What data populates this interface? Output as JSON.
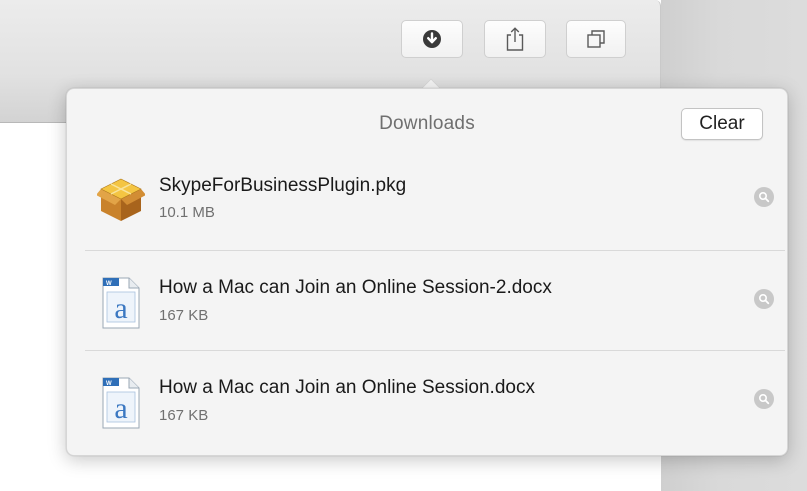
{
  "popover": {
    "title": "Downloads",
    "clear_label": "Clear"
  },
  "toolbar": {
    "buttons": [
      {
        "name": "downloads",
        "icon": "download-arrow-circle-icon"
      },
      {
        "name": "share",
        "icon": "share-icon"
      },
      {
        "name": "tabs",
        "icon": "tab-overview-icon"
      }
    ]
  },
  "downloads": [
    {
      "name": "SkypeForBusinessPlugin.pkg",
      "size": "10.1 MB",
      "icon": "package-icon"
    },
    {
      "name": "How a Mac can Join an Online Session-2.docx",
      "size": "167 KB",
      "icon": "word-document-icon"
    },
    {
      "name": "How a Mac can Join an Online Session.docx",
      "size": "167 KB",
      "icon": "word-document-icon"
    }
  ],
  "colors": {
    "popover_bg": "#f4f4f4",
    "title_text": "#6f6f6f",
    "reveal_icon": "#c8c8c8"
  }
}
